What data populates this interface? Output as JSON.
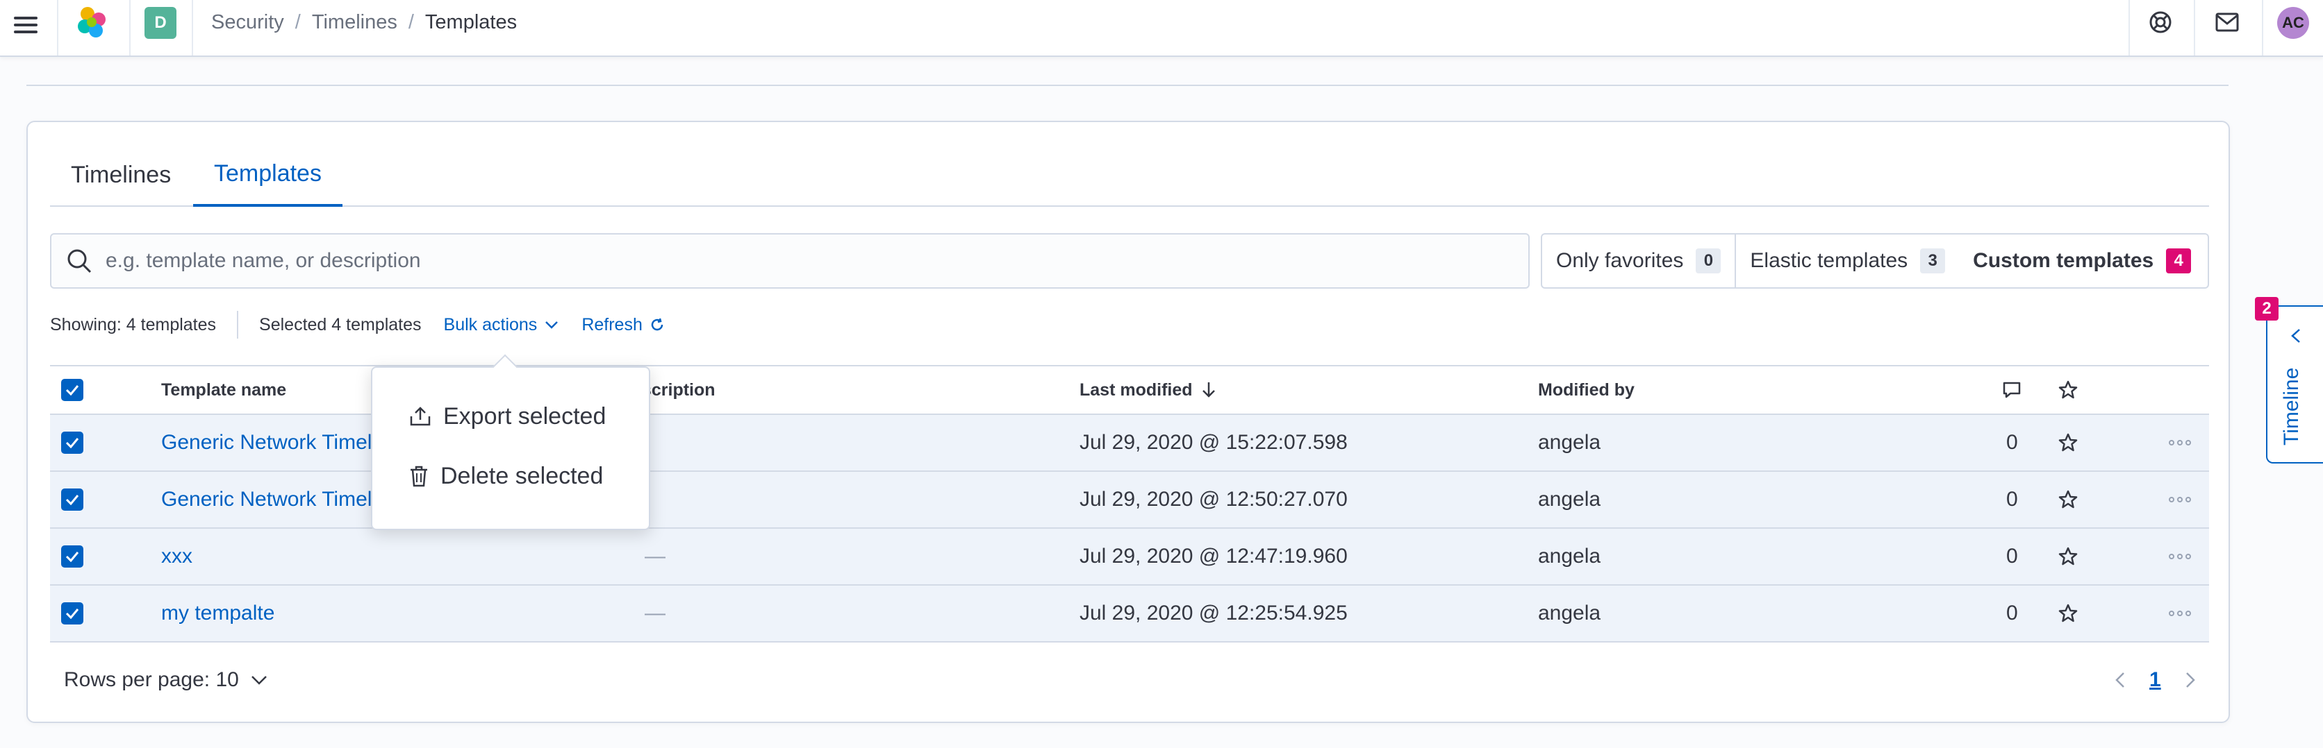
{
  "header": {
    "space_letter": "D",
    "breadcrumbs": [
      "Security",
      "Timelines",
      "Templates"
    ],
    "user_initials": "AC"
  },
  "tabs": [
    {
      "label": "Timelines"
    },
    {
      "label": "Templates"
    }
  ],
  "search": {
    "placeholder": "e.g. template name, or description",
    "value": ""
  },
  "filters": [
    {
      "label": "Only favorites",
      "count": "0"
    },
    {
      "label": "Elastic templates",
      "count": "3"
    },
    {
      "label": "Custom templates",
      "count": "4"
    }
  ],
  "utility": {
    "showing": "Showing: 4 templates",
    "selected": "Selected 4 templates",
    "bulk_actions": "Bulk actions",
    "refresh": "Refresh"
  },
  "table": {
    "columns": {
      "name": "Template name",
      "description": "Description",
      "last_modified": "Last modified",
      "modified_by": "Modified by"
    },
    "rows": [
      {
        "name": "Generic Network Timeline",
        "description": "",
        "last_modified": "Jul 29, 2020 @ 15:22:07.598",
        "modified_by": "angela",
        "notes": "0"
      },
      {
        "name": "Generic Network Timeline",
        "description": "",
        "last_modified": "Jul 29, 2020 @ 12:50:27.070",
        "modified_by": "angela",
        "notes": "0"
      },
      {
        "name": "xxx",
        "description": "—",
        "last_modified": "Jul 29, 2020 @ 12:47:19.960",
        "modified_by": "angela",
        "notes": "0"
      },
      {
        "name": "my tempalte",
        "description": "—",
        "last_modified": "Jul 29, 2020 @ 12:25:54.925",
        "modified_by": "angela",
        "notes": "0"
      }
    ]
  },
  "pagination": {
    "rows_per_page": "Rows per page: 10",
    "current_page": "1"
  },
  "bulk_menu": {
    "export": "Export selected",
    "delete": "Delete selected"
  },
  "timeline_flyout": {
    "label": "Timeline",
    "badge": "2"
  },
  "colors": {
    "accent": "#0061c2",
    "badge_pink": "#dd0a73",
    "space_badge": "#54b399",
    "avatar": "#b486d1"
  }
}
